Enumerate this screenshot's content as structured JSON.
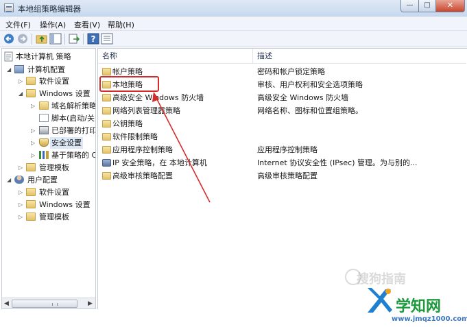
{
  "window": {
    "title": "本地组策略编辑器",
    "controls": {
      "minimize": "—",
      "maximize": "□",
      "close": "✕"
    }
  },
  "menubar": {
    "items": [
      "文件(F)",
      "操作(A)",
      "查看(V)",
      "帮助(H)"
    ]
  },
  "toolbar": {
    "icons": [
      "back-icon",
      "forward-icon",
      "up-folder-icon",
      "show-hide-tree-icon",
      "export-list-icon",
      "help-icon",
      "properties-icon"
    ]
  },
  "tree": {
    "items": [
      {
        "label": "本地计算机 策略",
        "icon": "policy-doc-icon",
        "expander": "",
        "level": 0
      },
      {
        "label": "计算机配置",
        "icon": "computer-icon",
        "expander": "◢",
        "level": 1
      },
      {
        "label": "软件设置",
        "icon": "folder-icon",
        "expander": "▷",
        "level": 2
      },
      {
        "label": "Windows 设置",
        "icon": "folder-icon",
        "expander": "◢",
        "level": 2
      },
      {
        "label": "域名解析策略",
        "icon": "folder-icon",
        "expander": "▷",
        "level": 3
      },
      {
        "label": "脚本(启动/关",
        "icon": "script-icon",
        "expander": "",
        "level": 3
      },
      {
        "label": "已部署的打印",
        "icon": "printer-icon",
        "expander": "▷",
        "level": 3
      },
      {
        "label": "安全设置",
        "icon": "security-icon",
        "expander": "▷",
        "level": 3,
        "selected": true
      },
      {
        "label": "基于策略的 C",
        "icon": "qos-chart-icon",
        "expander": "▷",
        "level": 3
      },
      {
        "label": "管理模板",
        "icon": "folder-icon",
        "expander": "▷",
        "level": 2
      },
      {
        "label": "用户配置",
        "icon": "user-icon",
        "expander": "◢",
        "level": 1
      },
      {
        "label": "软件设置",
        "icon": "folder-icon",
        "expander": "▷",
        "level": 2
      },
      {
        "label": "Windows 设置",
        "icon": "folder-icon",
        "expander": "▷",
        "level": 2
      },
      {
        "label": "管理模板",
        "icon": "folder-icon",
        "expander": "▷",
        "level": 2
      }
    ]
  },
  "list": {
    "columns": {
      "name": "名称",
      "description": "描述"
    },
    "rows": [
      {
        "name": "帐户策略",
        "description": "密码和帐户锁定策略",
        "icon": "policy-folder-icon"
      },
      {
        "name": "本地策略",
        "description": "审核、用户权利和安全选项策略",
        "icon": "policy-folder-icon",
        "highlighted": true
      },
      {
        "name": "高级安全 Windows 防火墙",
        "description": "高级安全 Windows 防火墙",
        "icon": "folder-icon"
      },
      {
        "name": "网络列表管理器策略",
        "description": "网络名称、图标和位置组策略。",
        "icon": "folder-icon"
      },
      {
        "name": "公钥策略",
        "description": "",
        "icon": "folder-icon"
      },
      {
        "name": "软件限制策略",
        "description": "",
        "icon": "folder-icon"
      },
      {
        "name": "应用程序控制策略",
        "description": "应用程序控制策略",
        "icon": "folder-icon"
      },
      {
        "name": "IP 安全策略，在 本地计算机",
        "description": "Internet 协议安全性 (IPsec) 管理。为与别的...",
        "icon": "ip-security-icon"
      },
      {
        "name": "高级审核策略配置",
        "description": "高级审核策略配置",
        "icon": "folder-icon"
      }
    ]
  },
  "annotation": {
    "color": "#d62b2b"
  },
  "watermarks": {
    "sogou": "搜狗指南",
    "site_name": "学知网",
    "site_url": "www.jmqz1000.com"
  }
}
